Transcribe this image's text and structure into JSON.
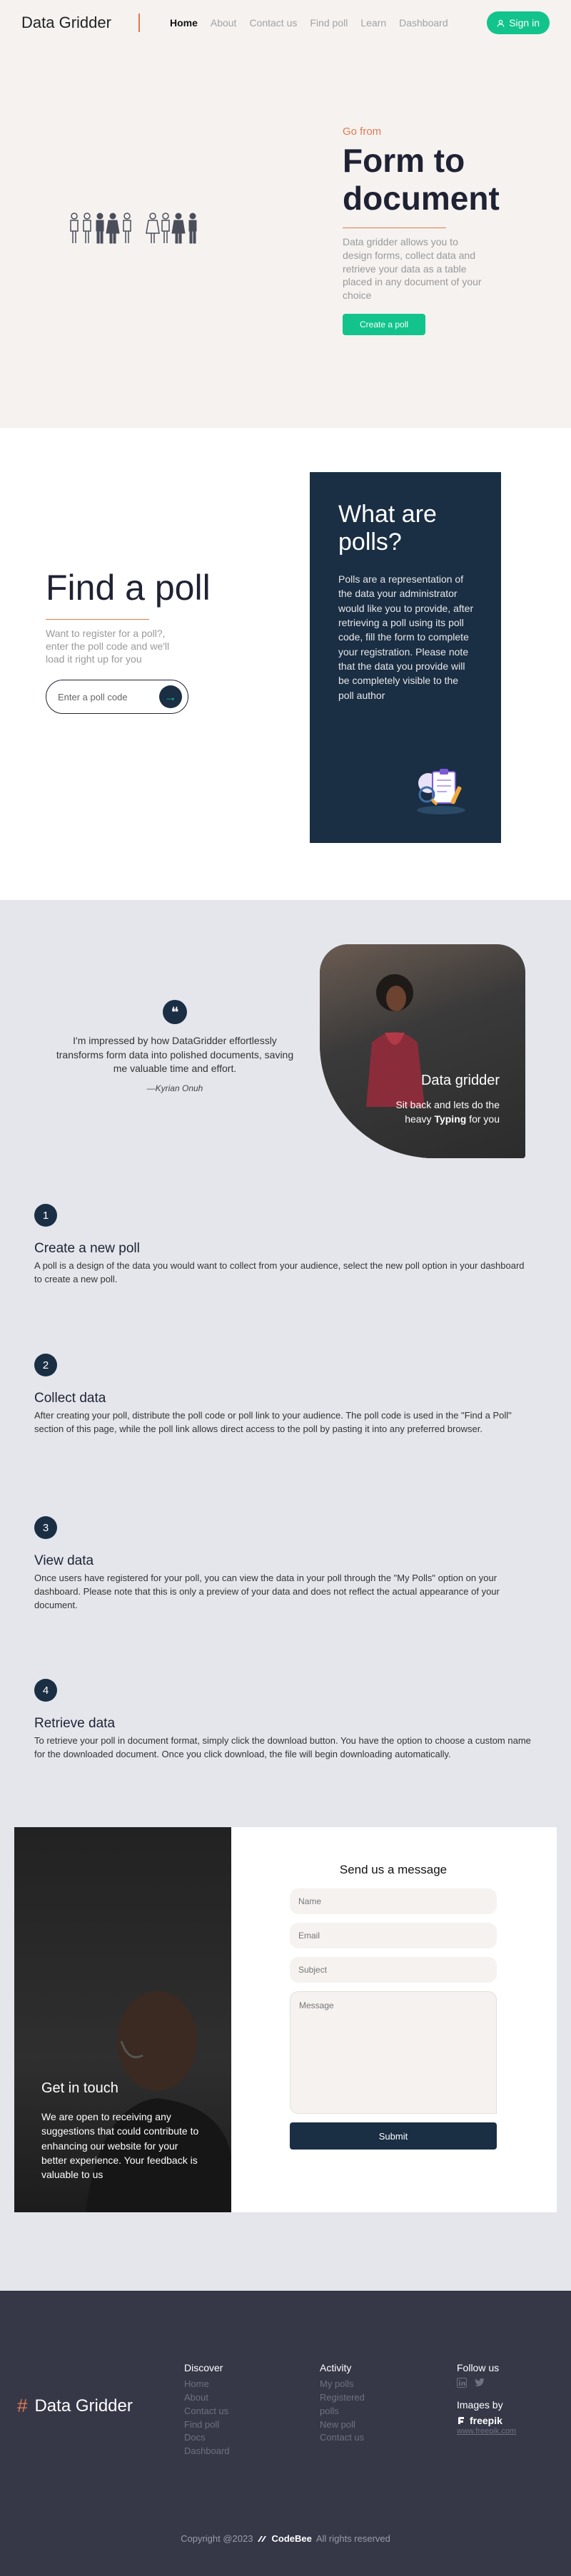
{
  "nav": {
    "brand": "Data Gridder",
    "links": [
      "Home",
      "About",
      "Contact us",
      "Find poll",
      "Learn",
      "Dashboard"
    ],
    "signin": "Sign in"
  },
  "hero": {
    "eyebrow": "Go from",
    "title": "Form to document",
    "description": "Data gridder allows you to design forms, collect data and retrieve your data as a table placed in any document of your choice",
    "cta": "Create a poll"
  },
  "find": {
    "title": "Find a poll",
    "description": "Want to register for a poll?, enter the poll code and we'll load it right up for you",
    "placeholder": "Enter a poll code"
  },
  "polls_card": {
    "title": "What are polls?",
    "text": "Polls are a representation of the data your administrator would like you to provide, after retrieving a poll using its poll code, fill the form to complete your registration. Please note that the data you provide will be completely visible to the poll author"
  },
  "testimonial": {
    "quote": "I'm impressed by how DataGridder effortlessly transforms form data into polished documents, saving me valuable time and effort.",
    "author": "—Kyrian Onuh"
  },
  "photo_card": {
    "title": "Data gridder",
    "text_before": "Sit back and lets do the heavy ",
    "text_bold": "Typing",
    "text_after": " for you"
  },
  "steps": [
    {
      "num": "1",
      "title": "Create a new poll",
      "text": "A poll is a design of the data you would want to collect from your audience, select the new poll option in your dashboard to create a new poll."
    },
    {
      "num": "2",
      "title": "Collect data",
      "text": "After creating your poll, distribute the poll code or poll link to your audience. The poll code is used in the \"Find a Poll\" section of this page, while the poll link allows direct access to the poll by pasting it into any preferred browser."
    },
    {
      "num": "3",
      "title": "View data",
      "text": "Once users have registered for your poll, you can view the data in your poll through the \"My Polls\" option on your dashboard. Please note that this is only a preview of your data and does not reflect the actual appearance of your document."
    },
    {
      "num": "4",
      "title": "Retrieve data",
      "text": "To retrieve your poll in document format, simply click the download button. You have the option to choose a custom name for the downloaded document. Once you click download, the file will begin downloading automatically."
    }
  ],
  "contact": {
    "image_title": "Get in touch",
    "image_text": "We are open to receiving any suggestions that could contribute to enhancing our website for your better experience. Your feedback is valuable to us",
    "form_title": "Send us a message",
    "name_placeholder": "Name",
    "email_placeholder": "Email",
    "subject_placeholder": "Subject",
    "message_placeholder": "Message",
    "submit": "Submit"
  },
  "footer": {
    "brand": "Data Gridder",
    "discover_title": "Discover",
    "discover_links": [
      "Home",
      "About",
      "Contact us",
      "Find poll",
      "Docs",
      "Dashboard"
    ],
    "activity_title": "Activity",
    "activity_links": [
      "My polls",
      "Registered polls",
      "New poll",
      "Contact us"
    ],
    "follow_title": "Follow us",
    "images_by": "Images by",
    "freepik": "freepik",
    "freepik_url": "www.freepik.com",
    "copyright": "Copyright @2023",
    "codebee": "CodeBee",
    "rights": "All rights reserved"
  },
  "colors": {
    "accent": "#e07a50",
    "green": "#12c48b",
    "navy": "#1a2e44"
  }
}
